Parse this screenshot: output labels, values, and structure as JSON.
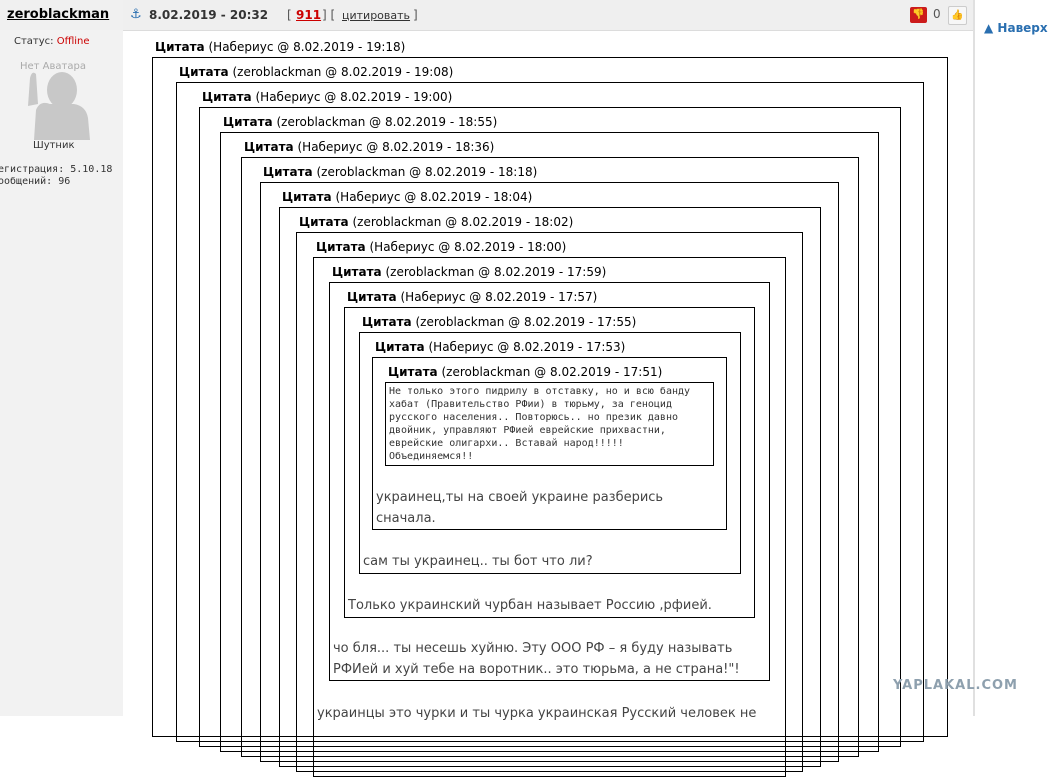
{
  "post": {
    "author": "zeroblackman",
    "date": "8.02.2019 - 20:32",
    "bracket_open": "[",
    "bracket_mid": "] [",
    "bracket_close": "]",
    "reply_count": "911",
    "quote_label": "цитировать",
    "rating": "0"
  },
  "profile": {
    "status_label": "Статус:",
    "status_value": "Offline",
    "avatar_text": "Нет Аватара",
    "rank": "Шутник",
    "registration": "егистрация: 5.10.18",
    "messages": "ообщений: 96"
  },
  "nav": {
    "to_top": "Наверх"
  },
  "quotes": [
    {
      "label": "Цитата",
      "meta": "(Набериус @ 8.02.2019 - 19:18)"
    },
    {
      "label": "Цитата",
      "meta": "(zeroblackman @ 8.02.2019 - 19:08)"
    },
    {
      "label": "Цитата",
      "meta": "(Набериус @ 8.02.2019 - 19:00)"
    },
    {
      "label": "Цитата",
      "meta": "(zeroblackman @ 8.02.2019 - 18:55)"
    },
    {
      "label": "Цитата",
      "meta": "(Набериус @ 8.02.2019 - 18:36)"
    },
    {
      "label": "Цитата",
      "meta": "(zeroblackman @ 8.02.2019 - 18:18)"
    },
    {
      "label": "Цитата",
      "meta": "(Набериус @ 8.02.2019 - 18:04)"
    },
    {
      "label": "Цитата",
      "meta": "(zeroblackman @ 8.02.2019 - 18:02)"
    },
    {
      "label": "Цитата",
      "meta": "(Набериус @ 8.02.2019 - 18:00)"
    },
    {
      "label": "Цитата",
      "meta": "(zeroblackman @ 8.02.2019 - 17:59)"
    },
    {
      "label": "Цитата",
      "meta": "(Набериус @ 8.02.2019 - 17:57)"
    },
    {
      "label": "Цитата",
      "meta": "(zeroblackman @ 8.02.2019 - 17:55)"
    },
    {
      "label": "Цитата",
      "meta": "(Набериус @ 8.02.2019 - 17:53)"
    },
    {
      "label": "Цитата",
      "meta": "(zeroblackman @ 8.02.2019 - 17:51)"
    }
  ],
  "innermost_quote_lines": [
    "Не только этого пидрилу в отставку, но и всю банду",
    "хабат (Правительство РФии) в тюрьму, за геноцид",
    "русского населения.. Повторюсь.. но презик давно",
    "двойник, управляют РФией еврейские прихвастни,",
    "еврейские олигархи..  Вставай народ!!!!!",
    "Объединяемся!!"
  ],
  "replies": [
    {
      "lines": [
        "украинец,ты на своей украине разберись",
        "сначала."
      ]
    },
    {
      "lines": [
        "сам ты украинец.. ты бот что ли?"
      ]
    },
    {
      "lines": [
        "Только украинский чурбан называет Россию ,рфией."
      ]
    },
    {
      "lines": [
        "чо бля... ты несешь хуйню. Эту ООО РФ – я буду называть",
        "РФИей и хуй тебе на воротник.. это тюрьма, а не страна!\"!"
      ]
    },
    {
      "lines": [
        "украинцы это чурки и ты чурка украинская Русский человек не"
      ]
    }
  ],
  "watermark": "YAPLAKAL.COM",
  "colors": {
    "link_blue": "#2a6fb0",
    "status_red": "#cc0000",
    "sidebar_bg": "#f2f2f2"
  }
}
